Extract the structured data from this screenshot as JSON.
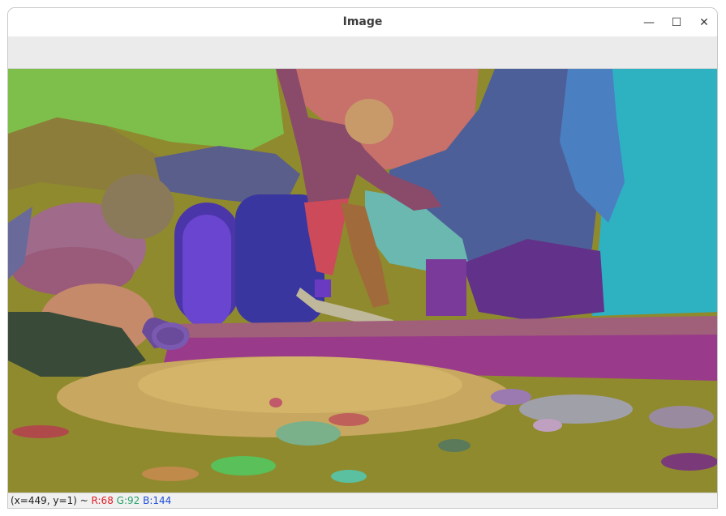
{
  "window": {
    "title": "Image",
    "minimize_glyph": "—",
    "maximize_glyph": "☐",
    "close_glyph": "✕"
  },
  "status": {
    "coords": "(x=449, y=1) ~",
    "r": "R:68",
    "g": "G:92",
    "b": "B:144"
  },
  "colors": {
    "red_channel": "#e01b24",
    "green_channel": "#26a269",
    "blue_channel": "#1c4fd8"
  },
  "icons": [
    "minimize-icon",
    "maximize-icon",
    "close-icon"
  ]
}
